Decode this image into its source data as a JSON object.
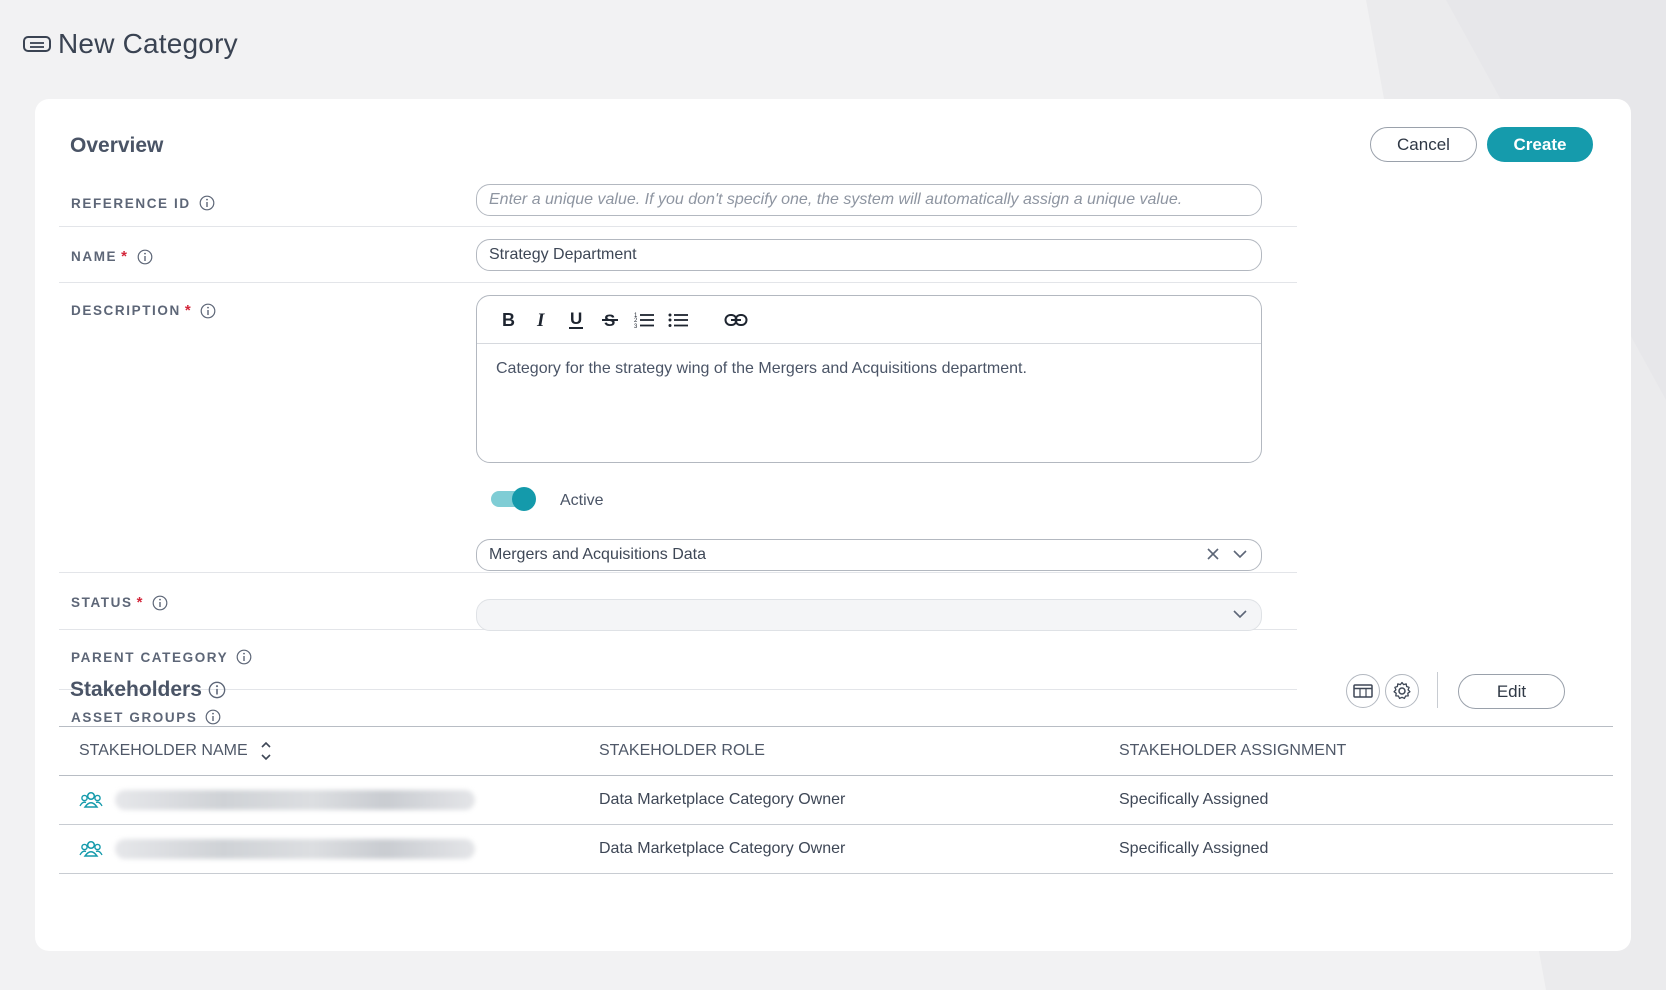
{
  "header": {
    "title": "New Category",
    "icon": "tag-icon"
  },
  "actions": {
    "cancel_label": "Cancel",
    "create_label": "Create"
  },
  "overview": {
    "title": "Overview",
    "reference_id": {
      "label": "REFERENCE ID",
      "value": "",
      "placeholder": "Enter a unique value. If you don't specify one, the system will automatically assign a unique value."
    },
    "name": {
      "label": "NAME",
      "required_mark": "*",
      "value": "Strategy Department"
    },
    "description": {
      "label": "DESCRIPTION",
      "required_mark": "*",
      "toolbar": [
        "bold-icon",
        "italic-icon",
        "underline-icon",
        "strikethrough-icon",
        "ordered-list-icon",
        "bullet-list-icon",
        "link-icon"
      ],
      "value": "Category for the strategy wing of the Mergers and Acquisitions department."
    },
    "status": {
      "label": "STATUS",
      "required_mark": "*",
      "value": "Active",
      "on": true
    },
    "parent_category": {
      "label": "PARENT CATEGORY",
      "value": "Mergers and Acquisitions Data"
    },
    "asset_groups": {
      "label": "ASSET GROUPS",
      "value": ""
    }
  },
  "stakeholders": {
    "title": "Stakeholders",
    "edit_label": "Edit",
    "columns": [
      "STAKEHOLDER NAME",
      "STAKEHOLDER ROLE",
      "STAKEHOLDER ASSIGNMENT"
    ],
    "rows": [
      {
        "name": "",
        "role": "Data Marketplace Category Owner",
        "assignment": "Specifically Assigned"
      },
      {
        "name": "",
        "role": "Data Marketplace Category Owner",
        "assignment": "Specifically Assigned"
      }
    ]
  },
  "colors": {
    "accent": "#159bac",
    "required": "#d3263a",
    "text": "#3e4756",
    "background": "#f2f2f3"
  }
}
